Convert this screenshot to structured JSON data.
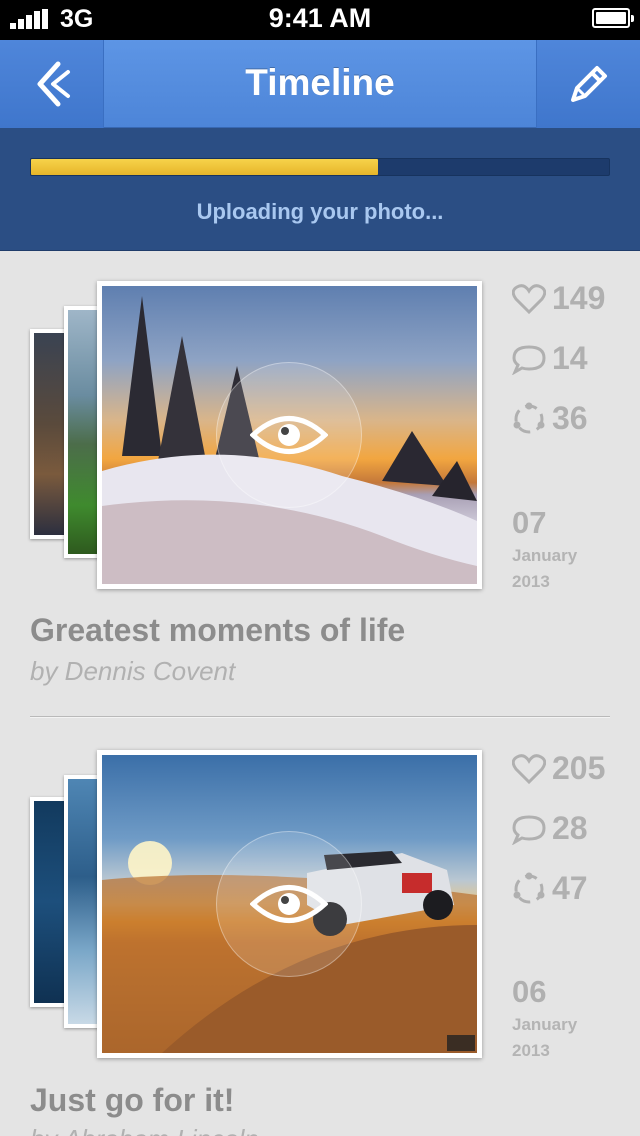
{
  "status_bar": {
    "carrier": "3G",
    "time": "9:41 AM"
  },
  "nav": {
    "title": "Timeline",
    "back_icon": "back-chevron-icon",
    "edit_icon": "pencil-icon"
  },
  "upload": {
    "label": "Uploading your photo...",
    "progress": 0.6,
    "bar_color": "#e9bb2e"
  },
  "colors": {
    "nav_blue": "#4d85d8",
    "panel_blue": "#2b4e84",
    "bg": "#e4e4e4"
  },
  "posts": [
    {
      "title": "Greatest moments of life",
      "author": "by Dennis Covent",
      "likes": "149",
      "comments": "14",
      "shares": "36",
      "day": "07",
      "month": "January",
      "year": "2013"
    },
    {
      "title": "Just go for it!",
      "author": "by Abraham Lincoln",
      "likes": "205",
      "comments": "28",
      "shares": "47",
      "day": "06",
      "month": "January",
      "year": "2013"
    }
  ]
}
